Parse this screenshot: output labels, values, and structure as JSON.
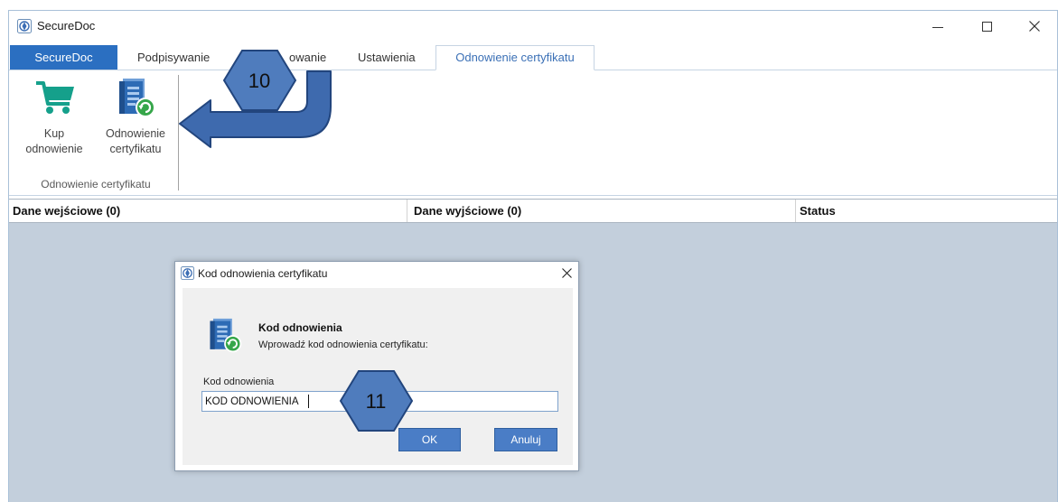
{
  "window": {
    "title": "SecureDoc",
    "logo_icon": "app-logo-icon",
    "controls": {
      "minimize_icon": "minimize-icon",
      "maximize_icon": "maximize-icon",
      "close_icon": "close-icon"
    }
  },
  "ribbon": {
    "tabs": [
      {
        "label": "SecureDoc"
      },
      {
        "label": "Podpisywanie"
      },
      {
        "label": "owanie"
      },
      {
        "label": "Ustawienia"
      },
      {
        "label": "Odnowienie certyfikatu",
        "active": true
      }
    ],
    "group": {
      "label": "Odnowienie certyfikatu",
      "buttons": [
        {
          "line1": "Kup",
          "line2": "odnowienie",
          "icon": "shopping-cart-icon"
        },
        {
          "line1": "Odnowienie",
          "line2": "certyfikatu",
          "icon": "certificate-renew-icon"
        }
      ]
    }
  },
  "table": {
    "columns": [
      "Dane wejściowe (0)",
      "Dane wyjściowe (0)",
      "Status"
    ]
  },
  "dialog": {
    "title": "Kod odnowienia certyfikatu",
    "heading": "Kod odnowienia",
    "description": "Wprowadź kod odnowienia certyfikatu:",
    "field_label": "Kod odnowienia",
    "field_value": "KOD ODNOWIENIA",
    "ok_label": "OK",
    "cancel_label": "Anuluj",
    "icon": "certificate-renew-icon"
  },
  "callouts": [
    {
      "number": "10"
    },
    {
      "number": "11"
    }
  ],
  "colors": {
    "app_tab": "#2b6fc1",
    "active_tab_text": "#3b70b6",
    "workspace": "#c3cfdc",
    "callout_fill": "#4f7cbd",
    "cart": "#15a08b",
    "dialog_button": "#4a7dc6"
  }
}
